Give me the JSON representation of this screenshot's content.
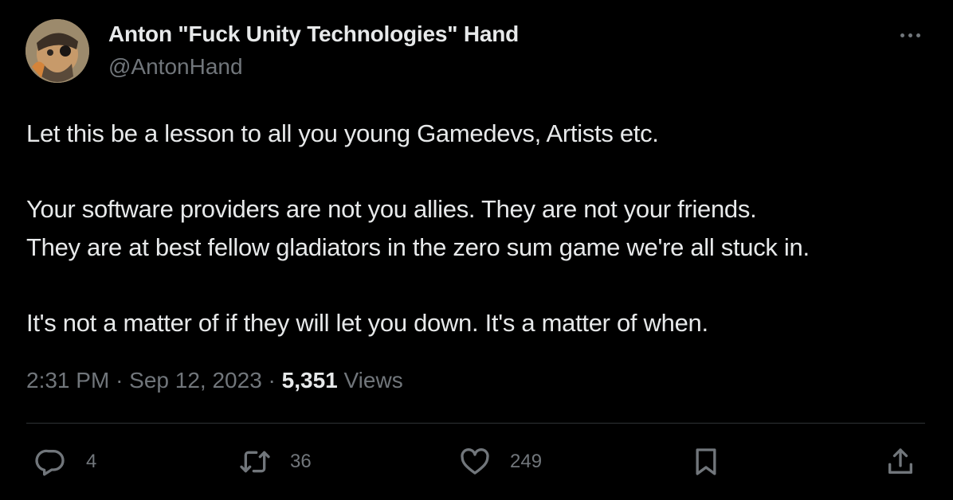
{
  "author": {
    "name": "Anton \"Fuck Unity Technologies\" Hand",
    "handle": "@AntonHand"
  },
  "tweet": {
    "paragraphs": [
      [
        "Let this be a lesson to all you young Gamedevs, Artists etc."
      ],
      [
        "Your software providers are not you allies. They are not your friends.",
        "They are at best fellow gladiators in the zero sum game we're all stuck in."
      ],
      [
        "It's not a matter of if they will let you down. It's a matter of when."
      ]
    ]
  },
  "meta": {
    "time": "2:31 PM",
    "separator": "·",
    "date": "Sep 12, 2023",
    "views_count": "5,351",
    "views_label": "Views"
  },
  "actions": {
    "reply_count": "4",
    "retweet_count": "36",
    "like_count": "249"
  },
  "icons": {
    "more": "more-horizontal-icon",
    "reply": "reply-icon",
    "retweet": "retweet-icon",
    "like": "heart-icon",
    "bookmark": "bookmark-icon",
    "share": "share-icon"
  },
  "colors": {
    "background": "#000000",
    "primary_text": "#e7e9ea",
    "secondary_text": "#71767b",
    "divider": "#2f3336"
  }
}
